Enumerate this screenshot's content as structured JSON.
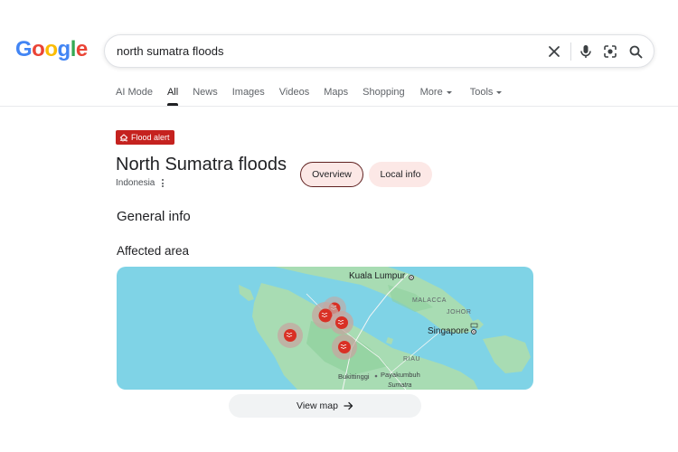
{
  "logo": {
    "letters": [
      "G",
      "o",
      "o",
      "g",
      "l",
      "e"
    ]
  },
  "search": {
    "query": "north sumatra floods",
    "icons": [
      "clear-icon",
      "microphone-icon",
      "lens-icon",
      "search-icon"
    ]
  },
  "tabs": [
    {
      "label": "AI Mode",
      "active": false
    },
    {
      "label": "All",
      "active": true
    },
    {
      "label": "News",
      "active": false
    },
    {
      "label": "Images",
      "active": false
    },
    {
      "label": "Videos",
      "active": false
    },
    {
      "label": "Maps",
      "active": false
    },
    {
      "label": "Shopping",
      "active": false
    },
    {
      "label": "More",
      "active": false,
      "caret": true
    },
    {
      "label": "Tools",
      "active": false,
      "caret": true
    }
  ],
  "alert": {
    "label": "Flood alert",
    "icon": "flood-house-icon",
    "color": "#c5221f"
  },
  "event": {
    "title": "North Sumatra floods",
    "location": "Indonesia"
  },
  "pills": {
    "overview": "Overview",
    "local_info": "Local info"
  },
  "sections": {
    "general_info": "General info",
    "affected_area": "Affected area"
  },
  "map": {
    "labels": {
      "kuala_lumpur": "Kuala Lumpur",
      "malacca": "MALACCA",
      "johor": "JOHOR",
      "singapore": "Singapore",
      "riau": "RIAU",
      "bukittinggi": "Bukittinggi",
      "payakumbuh": "Payakumbuh",
      "sumatra": "Sumatra"
    },
    "colors": {
      "water": "#7fd3e6",
      "land": "#a8dcb3",
      "marker": "#d93025"
    }
  },
  "view_map": {
    "label": "View map"
  }
}
